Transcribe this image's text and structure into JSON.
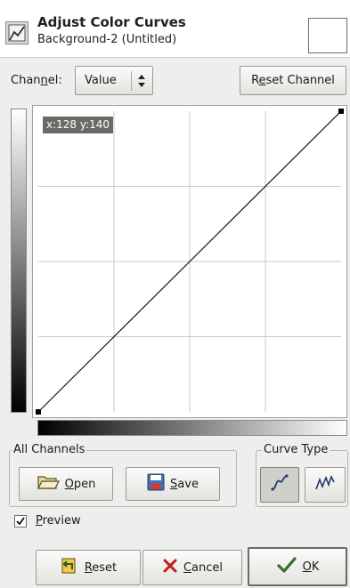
{
  "header": {
    "title": "Adjust Color Curves",
    "subtitle": "Background-2 (Untitled)",
    "tool_icon": "curves-tool-icon"
  },
  "channel": {
    "label_pre": "Chan",
    "label_u": "n",
    "label_post": "el:",
    "value": "Value",
    "reset_pre": "R",
    "reset_u": "e",
    "reset_post": "set Channel"
  },
  "curve": {
    "readout": "x:128 y:140",
    "points": [
      [
        0,
        0
      ],
      [
        255,
        255
      ]
    ],
    "grid_divisions": 4,
    "line_color": "#1a1a1a",
    "grid_color": "#c8c8c8"
  },
  "all_channels": {
    "label": "All Channels",
    "open_u": "O",
    "open_rest": "pen",
    "save_u": "S",
    "save_rest": "ave"
  },
  "curve_type": {
    "label": "Curve Type",
    "smooth_icon": "smooth-curve-icon",
    "freehand_icon": "freehand-curve-icon",
    "selected": "smooth"
  },
  "preview": {
    "checked": true,
    "label_u": "P",
    "label_rest": "review"
  },
  "buttons": {
    "reset_u": "R",
    "reset_rest": "eset",
    "cancel_u": "C",
    "cancel_rest": "ancel",
    "ok_u": "O",
    "ok_rest": "K"
  }
}
